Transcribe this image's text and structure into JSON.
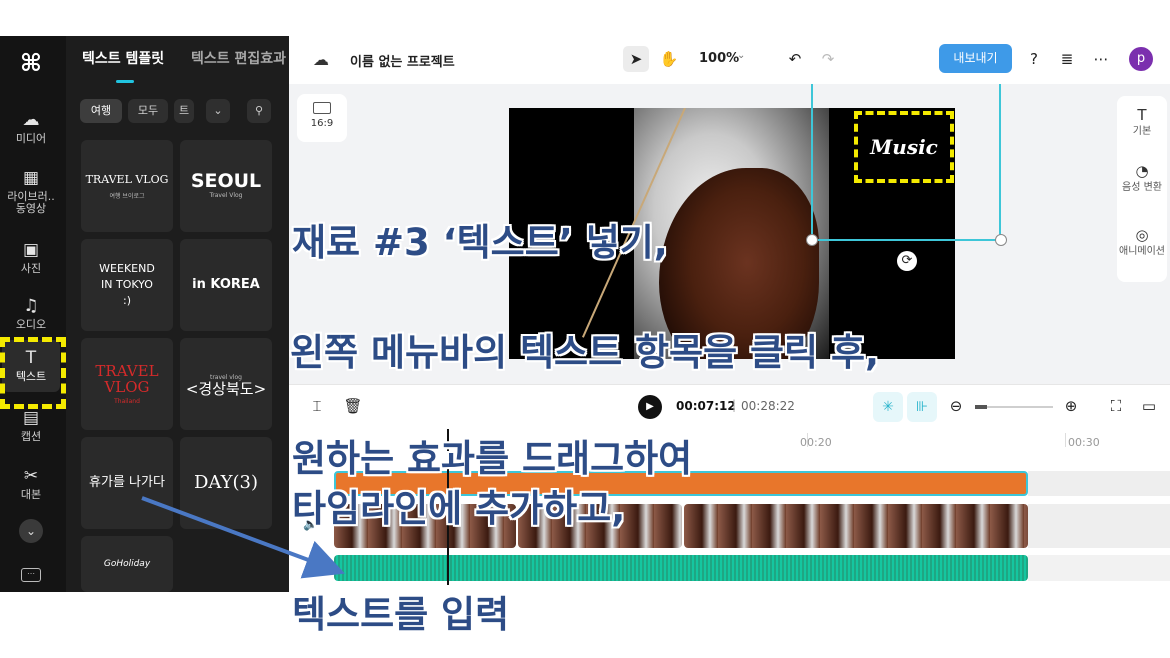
{
  "sidebar": {
    "items": [
      {
        "label": "미디어",
        "icon": "cloud-upload-icon"
      },
      {
        "label": "라이브러.. 동영상",
        "icon": "film-icon"
      },
      {
        "label": "사진",
        "icon": "image-icon"
      },
      {
        "label": "오디오",
        "icon": "music-note-icon"
      },
      {
        "label": "텍스트",
        "icon": "text-icon",
        "active": true
      },
      {
        "label": "캡션",
        "icon": "caption-icon"
      },
      {
        "label": "대본",
        "icon": "script-icon"
      }
    ],
    "collapse_icon": "chevron-down-icon",
    "keyboard_icon": "keyboard-icon"
  },
  "panel": {
    "tabs": [
      "텍스트 템플릿",
      "텍스트 편집효과"
    ],
    "chips": [
      "여행",
      "모두",
      "트"
    ],
    "templates": [
      {
        "main": "TRAVEL VLOG",
        "sub": "여행 브이로그"
      },
      {
        "main": "SEOUL",
        "sub": "Travel Vlog"
      },
      {
        "main": "WEEKEND IN TOKYO :)",
        "sub": ""
      },
      {
        "main": "in KOREA",
        "sub": ""
      },
      {
        "main": "TRAVEL VLOG",
        "sub": "Thailand"
      },
      {
        "main": "<경상북도>",
        "sub": "travel vlog"
      },
      {
        "main": "휴가를 나가다",
        "sub": ""
      },
      {
        "main": "DAY(3)",
        "sub": ""
      },
      {
        "main": "GoHoliday",
        "sub": ""
      }
    ]
  },
  "topbar": {
    "project_title": "이름 없는 프로젝트",
    "zoom": "100%",
    "export_label": "내보내기",
    "avatar_letter": "p",
    "icons": [
      "cloud-icon",
      "pointer-icon",
      "hand-icon",
      "undo-icon",
      "redo-icon",
      "help-icon",
      "stack-icon",
      "more-icon"
    ]
  },
  "canvas": {
    "ratio_label": "16:9",
    "music_text": "Music"
  },
  "properties": {
    "items": [
      "기본",
      "음성 변환",
      "애니메이션"
    ]
  },
  "timeline": {
    "current_time": "00:07:12",
    "separator": "|",
    "total_time": "00:28:22",
    "ruler": [
      "00:20",
      "00:30"
    ]
  },
  "overlay": {
    "step_title": "재료 #3 ‘텍스트’ 넣기,",
    "line1": "왼쪽 메뉴바의 텍스트 항목을 클릭 후,",
    "line2": "원하는 효과를 드래그하여",
    "line3": "타임라인에 추가하고,",
    "line4": "텍스트를 입력",
    "highlight_color": "#f4ea00",
    "text_color": "#2d4c86",
    "arrow_color": "#4a78c4"
  }
}
